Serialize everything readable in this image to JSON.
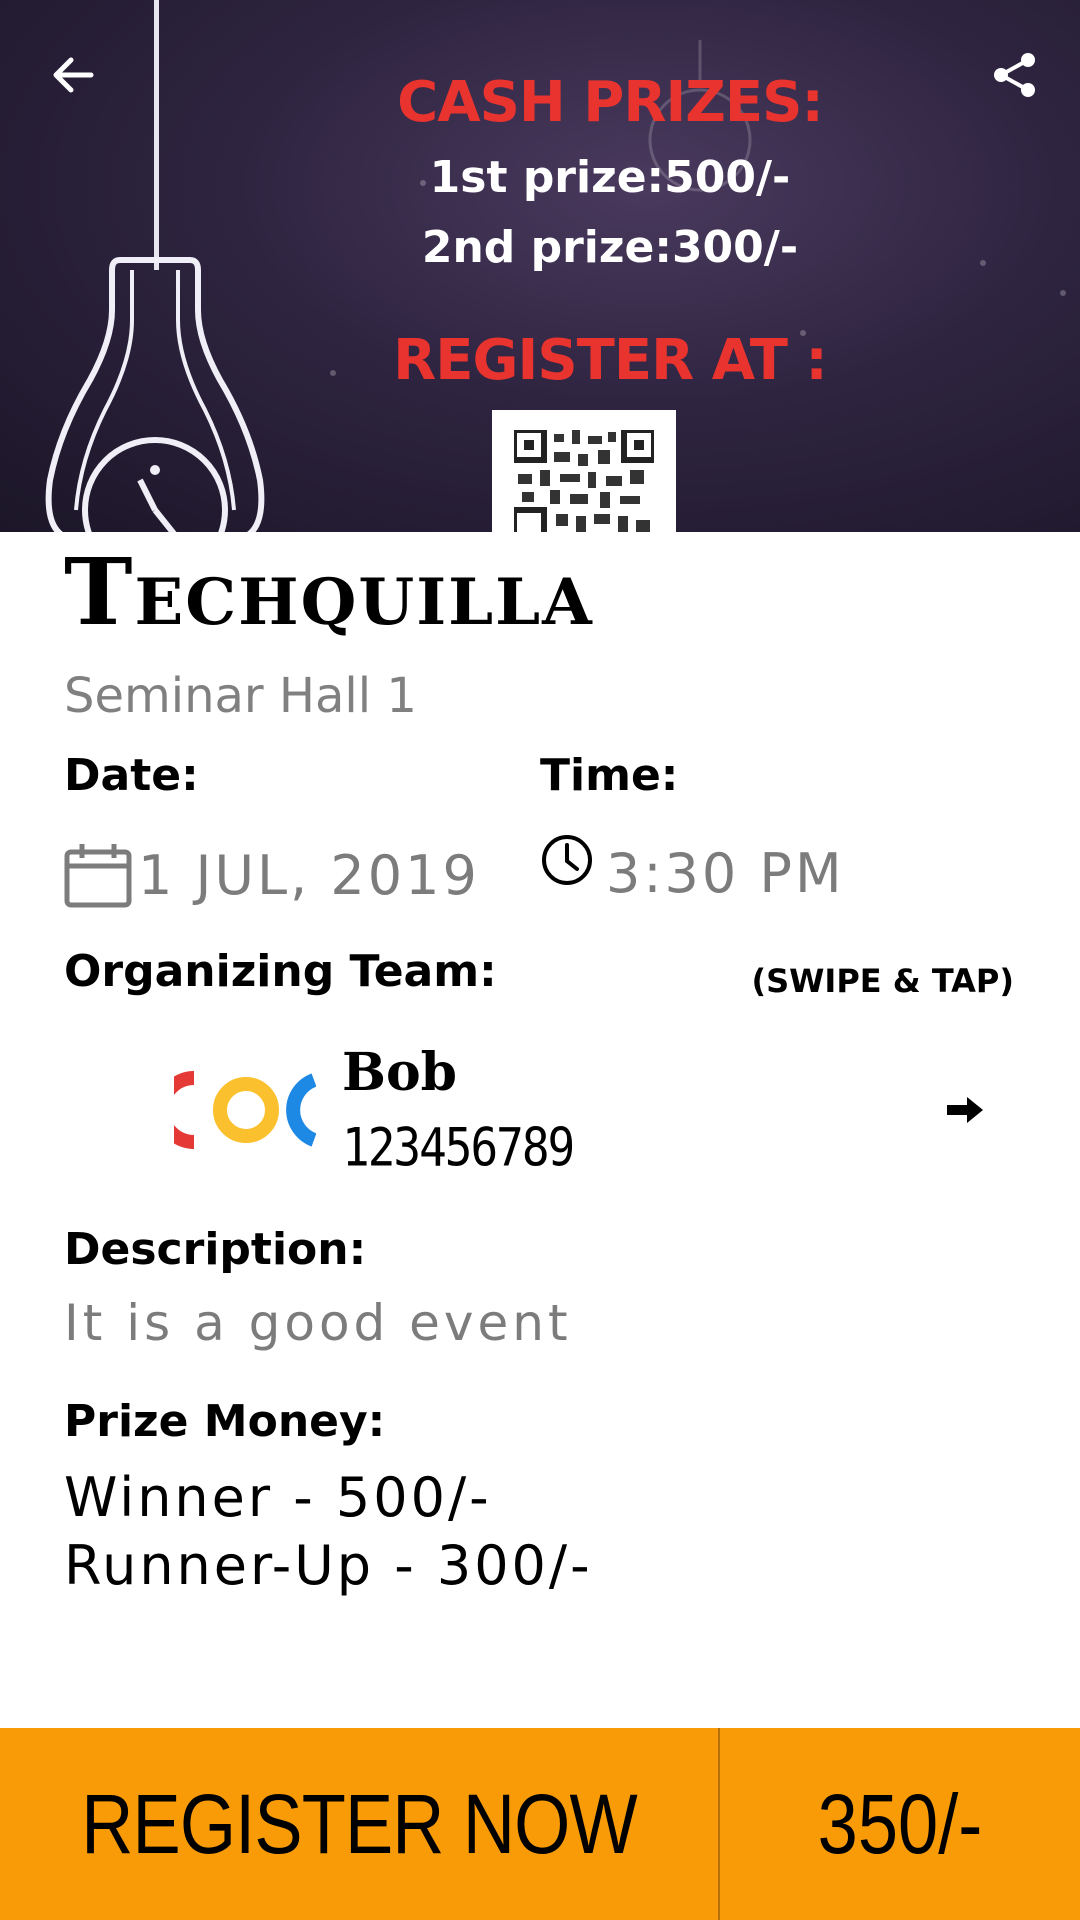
{
  "banner": {
    "cash_title": "CASH PRIZES:",
    "prize_1": "1st prize:500/-",
    "prize_2": "2nd prize:300/-",
    "register_at": "REGISTER AT :"
  },
  "event": {
    "title": "Techquilla",
    "venue": "Seminar Hall 1",
    "date_label": "Date:",
    "date": "1 JUL, 2019",
    "time_label": "Time:",
    "time": "3:30 PM"
  },
  "organizing": {
    "label": "Organizing Team:",
    "hint": "(SWIPE & TAP)",
    "members": [
      {
        "name": "Bob",
        "phone": "123456789"
      }
    ]
  },
  "description": {
    "label": "Description:",
    "text": "It is a good event"
  },
  "prize_money": {
    "label": "Prize Money:",
    "lines": [
      "Winner - 500/-",
      "Runner-Up - 300/-"
    ]
  },
  "bottom_bar": {
    "register_label": "REGISTER NOW",
    "price": "350/-"
  },
  "icons": {
    "back": "arrow-back-icon",
    "share": "share-icon",
    "calendar": "calendar-icon",
    "clock": "clock-icon",
    "arrow": "arrow-right-icon"
  },
  "colors": {
    "accent": "#f99b06",
    "banner_red": "#e8332f",
    "muted_text": "#7c7c7c"
  }
}
